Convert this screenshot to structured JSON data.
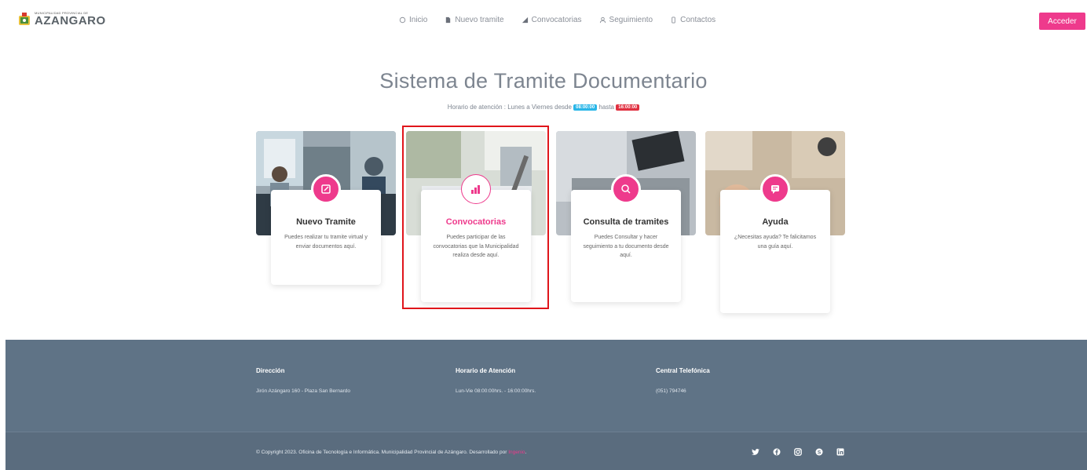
{
  "brand": {
    "tagline": "MUNICIPALIDAD PROVINCIAL DE",
    "name": "AZANGARO"
  },
  "nav": [
    {
      "label": "Inicio",
      "icon": "home-icon"
    },
    {
      "label": "Nuevo tramite",
      "icon": "document-icon"
    },
    {
      "label": "Convocatorias",
      "icon": "chart-icon"
    },
    {
      "label": "Seguimiento",
      "icon": "user-icon"
    },
    {
      "label": "Contactos",
      "icon": "phone-icon"
    }
  ],
  "login_button": "Acceder",
  "hero": {
    "title": "Sistema de Tramite Documentario",
    "hours_prefix": "Horario de atención : Lunes a Viernes desde",
    "start_time": "08:00:00",
    "hours_mid": "hasta",
    "end_time": "16:00:00"
  },
  "cards": [
    {
      "title": "Nuevo Tramite",
      "desc": "Puedes realizar tu tramite virtual y enviar documentos aquí.",
      "icon": "edit-icon"
    },
    {
      "title": "Convocatorias",
      "desc": "Puedes participar de las convocatorias que la Municipalidad realiza desde aquí.",
      "icon": "bar-chart-icon"
    },
    {
      "title": "Consulta de tramites",
      "desc": "Puedes Consultar y hacer seguimiento a tu documento desde aquí.",
      "icon": "search-icon"
    },
    {
      "title": "Ayuda",
      "desc": "¿Necesitas ayuda? Te falicitamos una guía aquí.",
      "icon": "chat-icon"
    }
  ],
  "footer": {
    "address_label": "Dirección",
    "address": "Jirón Azángaro 160 - Plaza San Bernardo",
    "hours_label": "Horario de Atención",
    "hours": "Lun-Vie 08:00:00hrs. - 16:00:00hrs.",
    "phone_label": "Central Telefónica",
    "phone": "(051) 794746",
    "copyright": "© Copyright 2023. Oficina de Tecnología e Informática. Municipalidad Provincial de Azángaro. Desarrollado por",
    "developer": "Ingenio",
    "social": [
      "twitter-icon",
      "facebook-icon",
      "instagram-icon",
      "skype-icon",
      "linkedin-icon"
    ]
  },
  "colors": {
    "accent": "#ee3a8c",
    "footer": "#5f7386",
    "highlight": "#e0151b"
  }
}
